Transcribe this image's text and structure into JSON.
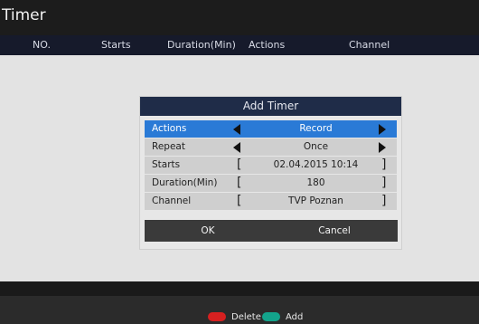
{
  "app": {
    "title": "Timer"
  },
  "table": {
    "headers": [
      "NO.",
      "Starts",
      "Duration(Min)",
      "Actions",
      "Channel"
    ]
  },
  "dialog": {
    "title": "Add Timer",
    "rows": [
      {
        "label": "Actions",
        "value": "Record"
      },
      {
        "label": "Repeat",
        "value": "Once"
      },
      {
        "label": "Starts",
        "value": "02.04.2015 10:14"
      },
      {
        "label": "Duration(Min)",
        "value": "180"
      },
      {
        "label": "Channel",
        "value": "TVP Poznan"
      }
    ],
    "ok_label": "OK",
    "cancel_label": "Cancel"
  },
  "footer": {
    "delete_label": "Delete",
    "add_label": "Add",
    "colors": {
      "delete": "#d62020",
      "add": "#13a38b",
      "highlight": "#2a7ad6"
    }
  }
}
